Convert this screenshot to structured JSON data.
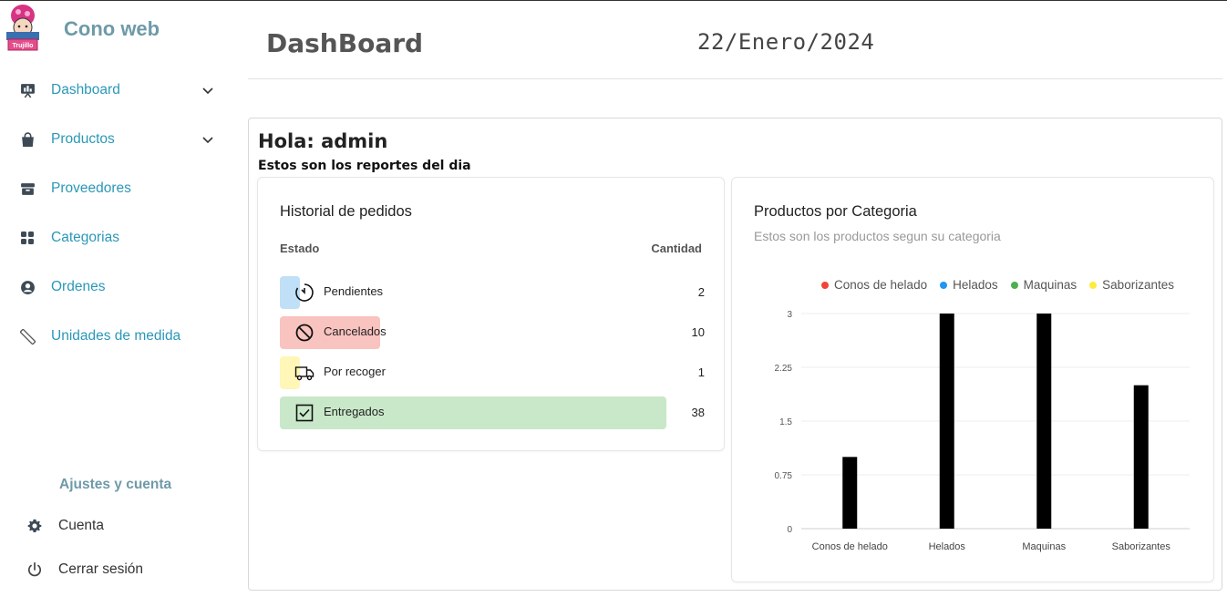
{
  "sidebar": {
    "brand": "Cono web",
    "logo_text": "Trujillo",
    "items": [
      {
        "label": "Dashboard",
        "icon": "presentation-icon",
        "has_chevron": true
      },
      {
        "label": "Productos",
        "icon": "shopping-bag-icon",
        "has_chevron": true
      },
      {
        "label": "Proveedores",
        "icon": "archive-box-icon",
        "has_chevron": false
      },
      {
        "label": "Categorias",
        "icon": "grid-icon",
        "has_chevron": false
      },
      {
        "label": "Ordenes",
        "icon": "user-circle-icon",
        "has_chevron": false
      },
      {
        "label": "Unidades de medida",
        "icon": "ruler-icon",
        "has_chevron": false
      }
    ],
    "settings_title": "Ajustes y cuenta",
    "settings": [
      {
        "label": "Cuenta",
        "icon": "gear-icon"
      },
      {
        "label": "Cerrar sesión",
        "icon": "power-icon"
      }
    ]
  },
  "header": {
    "title": "DashBoard",
    "date": "22/Enero/2024"
  },
  "main": {
    "greeting": "Hola: admin",
    "subtitle": "Estos son los reportes del dia"
  },
  "orders": {
    "title": "Historial de pedidos",
    "col_status": "Estado",
    "col_qty": "Cantidad",
    "rows": [
      {
        "label": "Pendientes",
        "qty": "2",
        "fraction": 0.05,
        "color": "#bfe0f7",
        "icon": "timer-icon"
      },
      {
        "label": "Cancelados",
        "qty": "10",
        "fraction": 0.26,
        "color": "#f9c3c0",
        "icon": "ban-icon"
      },
      {
        "label": "Por recoger",
        "qty": "1",
        "fraction": 0.02,
        "color": "#fff6b8",
        "icon": "truck-icon"
      },
      {
        "label": "Entregados",
        "qty": "38",
        "fraction": 1.0,
        "color": "#c9e8c9",
        "icon": "check-square-icon"
      }
    ]
  },
  "chart_data": {
    "type": "bar",
    "title": "Productos por Categoria",
    "subtitle": "Estos son los productos segun su categoria",
    "categories": [
      "Conos de helado",
      "Helados",
      "Maquinas",
      "Saborizantes"
    ],
    "values": [
      1,
      3,
      3,
      2
    ],
    "ylim": [
      0,
      3
    ],
    "yticks": [
      "0",
      "0.75",
      "1.5",
      "2.25",
      "3"
    ],
    "legend": [
      {
        "name": "Conos de helado",
        "color": "#f44336"
      },
      {
        "name": "Helados",
        "color": "#2196f3"
      },
      {
        "name": "Maquinas",
        "color": "#4caf50"
      },
      {
        "name": "Saborizantes",
        "color": "#ffeb3b"
      }
    ],
    "legend_position": "top",
    "bar_color": "#000000",
    "grid": true
  }
}
